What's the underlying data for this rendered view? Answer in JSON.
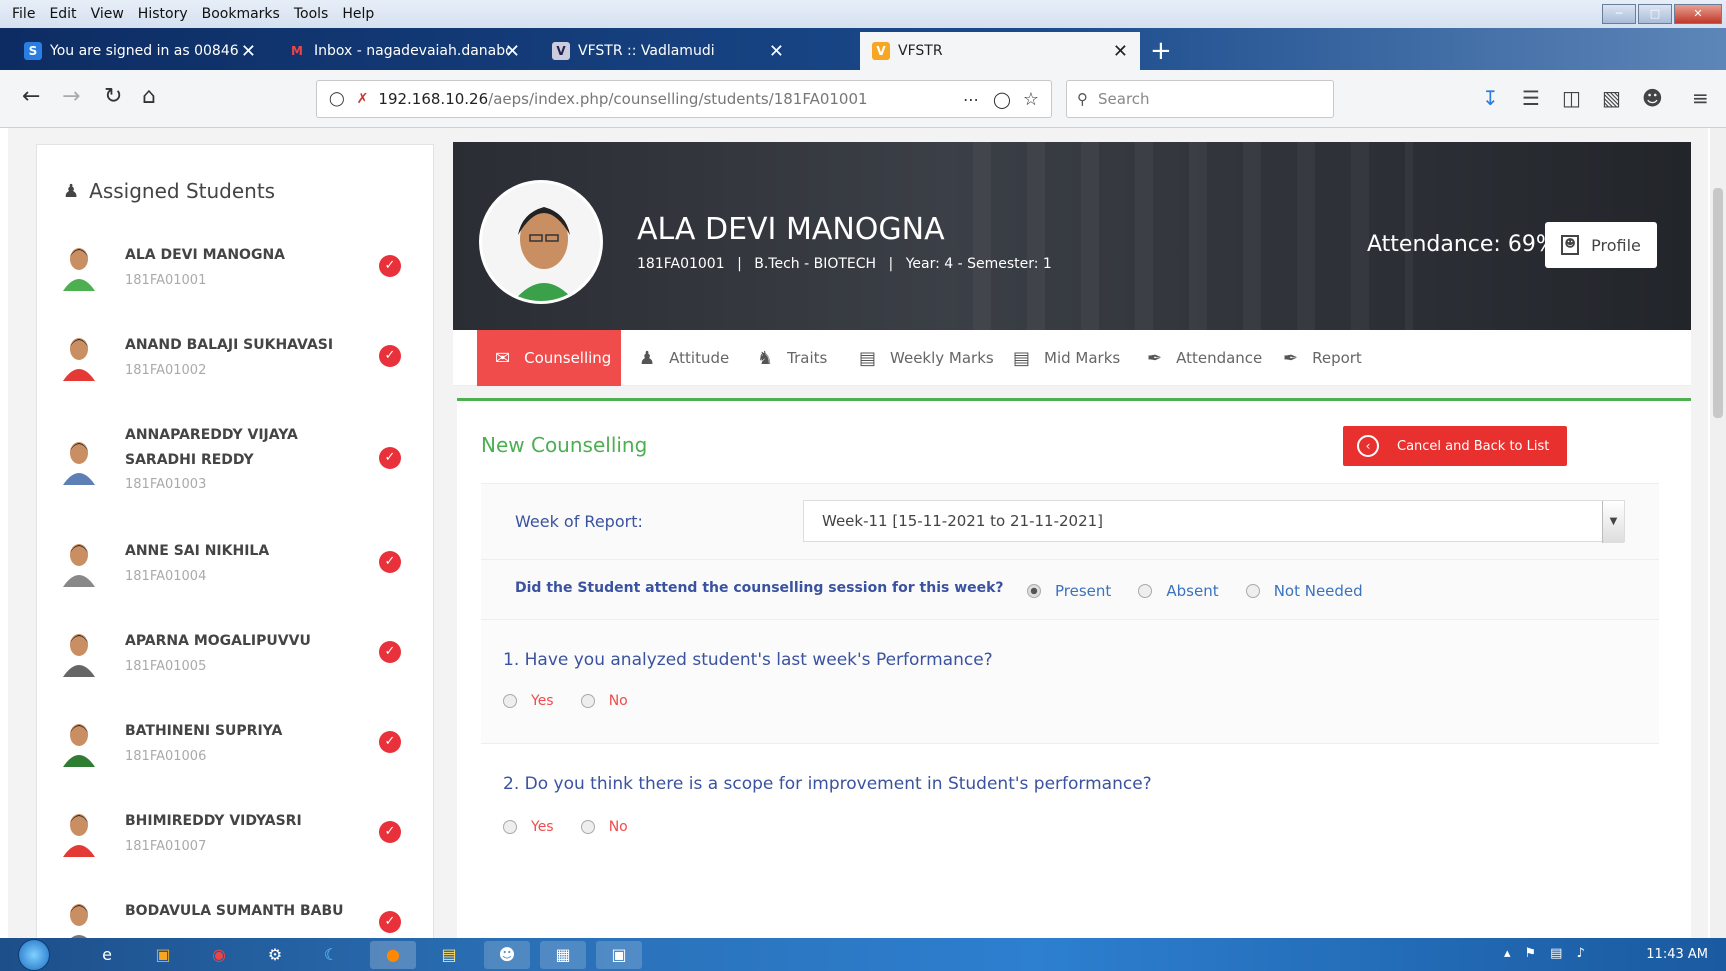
{
  "menubar": [
    "File",
    "Edit",
    "View",
    "History",
    "Bookmarks",
    "Tools",
    "Help"
  ],
  "browser_tabs": [
    {
      "label": "You are signed in as 00846",
      "icon": "S"
    },
    {
      "label": "Inbox - nagadevaiah.danaboin",
      "icon": "M"
    },
    {
      "label": "VFSTR :: Vadlamudi",
      "icon": "V"
    },
    {
      "label": "VFSTR",
      "icon": "V"
    }
  ],
  "url": {
    "host": "192.168.10.26",
    "path": "/aeps/index.php/counselling/students/181FA01001"
  },
  "search_placeholder": "Search",
  "left_panel": {
    "title": "Assigned Students",
    "students": [
      {
        "name": "ALA DEVI MANOGNA",
        "id": "181FA01001",
        "color": "#4caf50"
      },
      {
        "name": "ANAND BALAJI SUKHAVASI",
        "id": "181FA01002",
        "color": "#e53935"
      },
      {
        "name": "ANNAPAREDDY VIJAYA SARADHI REDDY",
        "id": "181FA01003",
        "color": "#5c7fb5"
      },
      {
        "name": "ANNE SAI NIKHILA",
        "id": "181FA01004",
        "color": "#888"
      },
      {
        "name": "APARNA MOGALIPUVVU",
        "id": "181FA01005",
        "color": "#666"
      },
      {
        "name": "BATHINENI SUPRIYA",
        "id": "181FA01006",
        "color": "#2e7d32"
      },
      {
        "name": "BHIMIREDDY VIDYASRI",
        "id": "181FA01007",
        "color": "#e53935"
      },
      {
        "name": "BODAVULA SUMANTH BABU",
        "id": "",
        "color": "#777"
      }
    ]
  },
  "student": {
    "name": "ALA DEVI MANOGNA",
    "id": "181FA01001",
    "program": "B.Tech - BIOTECH",
    "year_sem": "Year: 4 - Semester: 1",
    "attendance": "Attendance: 69%",
    "profile_button": "Profile"
  },
  "tabs": [
    "Counselling",
    "Attitude",
    "Traits",
    "Weekly Marks",
    "Mid Marks",
    "Attendance",
    "Report"
  ],
  "form": {
    "title": "New Counselling",
    "cancel_button": "Cancel and Back to List",
    "week_label": "Week of Report:",
    "week_value": "Week-11 [15-11-2021 to 21-11-2021]",
    "attend_question": "Did the Student attend the counselling session for this week?",
    "attend_options": [
      "Present",
      "Absent",
      "Not Needed"
    ],
    "attend_selected": "Present",
    "questions": [
      {
        "text": "1. Have you analyzed student's last week's Performance?",
        "options": [
          "Yes",
          "No"
        ]
      },
      {
        "text": "2. Do you think there is a scope for improvement in Student's performance?",
        "options": [
          "Yes",
          "No"
        ]
      }
    ]
  },
  "clock": "11:43 AM"
}
